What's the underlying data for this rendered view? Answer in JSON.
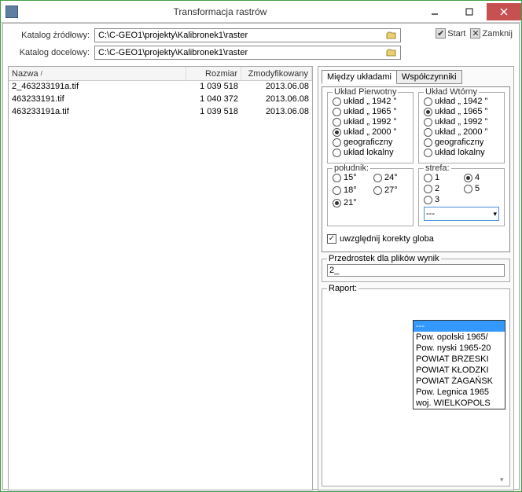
{
  "window": {
    "title": "Transformacja rastrów"
  },
  "paths": {
    "source_label": "Katalog źródłowy:",
    "source_value": "C:\\C-GEO1\\projekty\\Kalibronek1\\raster",
    "target_label": "Katalog docelowy:",
    "target_value": "C:\\C-GEO1\\projekty\\Kalibronek1\\raster"
  },
  "toolbar": {
    "start_label": "Start",
    "close_label": "Zamknij"
  },
  "files": {
    "columns": {
      "name": "Nazwa",
      "size": "Rozmiar",
      "date": "Zmodyfikowany"
    },
    "rows": [
      {
        "name": "2_463233191a.tif",
        "size": "1 039 518",
        "date": "2013.06.08"
      },
      {
        "name": "463233191.tif",
        "size": "1 040 372",
        "date": "2013.06.08"
      },
      {
        "name": "463233191a.tif",
        "size": "1 039 518",
        "date": "2013.06.08"
      }
    ]
  },
  "tabs": {
    "t1": "Między układami",
    "t2": "Współczynniki"
  },
  "primary": {
    "legend": "Układ Pierwotny",
    "o1": "układ „ 1942 ”",
    "o2": "układ „ 1965 ”",
    "o3": "układ „ 1992 ”",
    "o4": "układ „ 2000 ”",
    "o5": "geograficzny",
    "o6": "układ lokalny"
  },
  "secondary": {
    "legend": "Układ Wtórny",
    "o1": "układ „ 1942 ”",
    "o2": "układ „ 1965 ”",
    "o3": "układ „ 1992 ”",
    "o4": "układ „ 2000 ”",
    "o5": "geograficzny",
    "o6": "układ lokalny"
  },
  "poludnik": {
    "legend": "południk:",
    "v15": "15°",
    "v24": "24°",
    "v18": "18°",
    "v27": "27°",
    "v21": "21°"
  },
  "strefa": {
    "legend": "strefa:",
    "s1": "1",
    "s2": "2",
    "s3": "3",
    "s4": "4",
    "s5": "5",
    "selected": "---"
  },
  "dropdown": {
    "i0": "---",
    "i1": "Pow. opolski 1965/",
    "i2": "Pow. nyski 1965-20",
    "i3": "POWIAT BRZESKI",
    "i4": "POWIAT KŁODZKI",
    "i5": "POWIAT ŻAGAŃSK",
    "i6": "Pow. Legnica 1965",
    "i7": "woj. WIELKOPOLS"
  },
  "prefix": {
    "legend": "Przedrostek dla plików wynik",
    "value": "2_"
  },
  "report": {
    "legend": "Raport:"
  },
  "global_corr": {
    "label": "uwzględnij korekty globa"
  }
}
